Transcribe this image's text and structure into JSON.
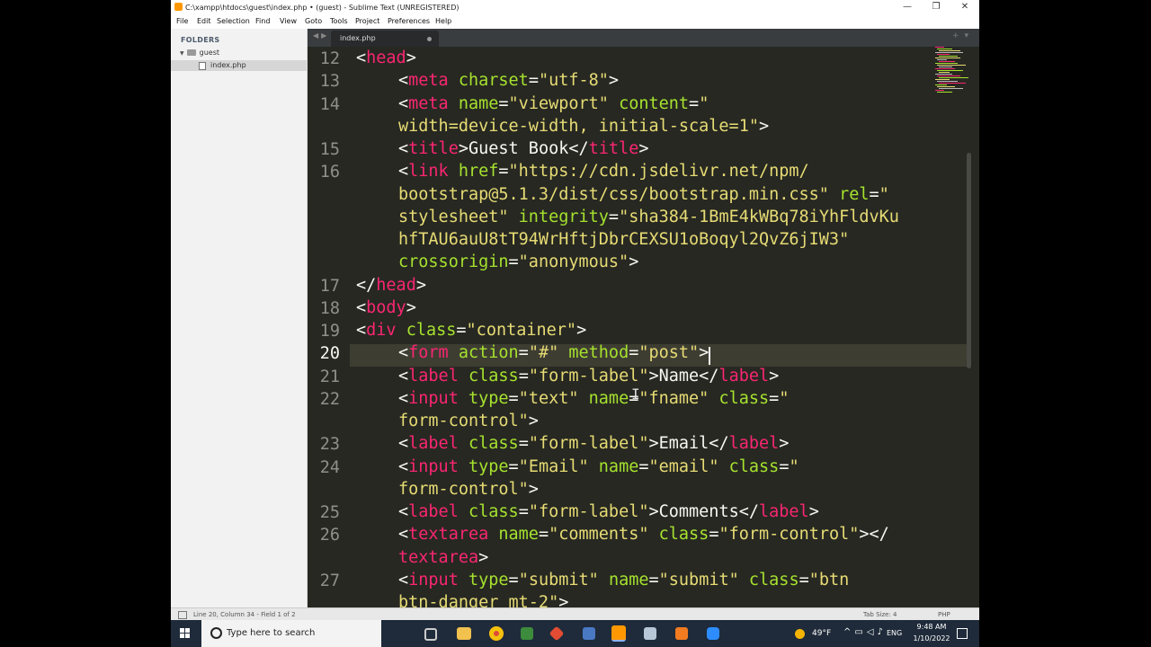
{
  "window": {
    "title": "C:\\xampp\\htdocs\\guest\\index.php • (guest) - Sublime Text (UNREGISTERED)",
    "controls": {
      "minimize": "—",
      "restore": "❐",
      "close": "✕"
    }
  },
  "menu": [
    "File",
    "Edit",
    "Selection",
    "Find",
    "View",
    "Goto",
    "Tools",
    "Project",
    "Preferences",
    "Help"
  ],
  "sidebar": {
    "header": "FOLDERS",
    "folder": "guest",
    "file": "index.php"
  },
  "tabs": [
    {
      "label": "index.php",
      "modified": true
    }
  ],
  "editor": {
    "active_line": "20",
    "gutter": [
      {
        "n": "12"
      },
      {
        "n": "13"
      },
      {
        "n": "14"
      },
      {
        "n": ""
      },
      {
        "n": "15"
      },
      {
        "n": "16"
      },
      {
        "n": ""
      },
      {
        "n": ""
      },
      {
        "n": ""
      },
      {
        "n": ""
      },
      {
        "n": "17"
      },
      {
        "n": "18"
      },
      {
        "n": "19"
      },
      {
        "n": "20"
      },
      {
        "n": "21"
      },
      {
        "n": "22"
      },
      {
        "n": ""
      },
      {
        "n": "23"
      },
      {
        "n": "24"
      },
      {
        "n": ""
      },
      {
        "n": "25"
      },
      {
        "n": "26"
      },
      {
        "n": ""
      },
      {
        "n": "27"
      },
      {
        "n": ""
      }
    ],
    "lines": [
      {
        "tokens": [
          [
            "p",
            "<"
          ],
          [
            "t",
            "head"
          ],
          [
            "p",
            ">"
          ]
        ]
      },
      {
        "in": 1,
        "tokens": [
          [
            "p",
            "<"
          ],
          [
            "t",
            "meta"
          ],
          [
            "p",
            " "
          ],
          [
            "a",
            "charset"
          ],
          [
            "p",
            "="
          ],
          [
            "s",
            "\"utf-8\""
          ],
          [
            "p",
            ">"
          ]
        ]
      },
      {
        "in": 1,
        "tokens": [
          [
            "p",
            "<"
          ],
          [
            "t",
            "meta"
          ],
          [
            "p",
            " "
          ],
          [
            "a",
            "name"
          ],
          [
            "p",
            "="
          ],
          [
            "s",
            "\"viewport\""
          ],
          [
            "p",
            " "
          ],
          [
            "a",
            "content"
          ],
          [
            "p",
            "="
          ],
          [
            "s",
            "\""
          ]
        ]
      },
      {
        "in": 1,
        "tokens": [
          [
            "s",
            "width=device-width, initial-scale=1\""
          ],
          [
            "p",
            ">"
          ]
        ]
      },
      {
        "in": 1,
        "tokens": [
          [
            "p",
            "<"
          ],
          [
            "t",
            "title"
          ],
          [
            "p",
            ">Guest Book</"
          ],
          [
            "t",
            "title"
          ],
          [
            "p",
            ">"
          ]
        ]
      },
      {
        "in": 1,
        "tokens": [
          [
            "p",
            "<"
          ],
          [
            "t",
            "link"
          ],
          [
            "p",
            " "
          ],
          [
            "a",
            "href"
          ],
          [
            "p",
            "="
          ],
          [
            "s",
            "\"https://cdn.jsdelivr.net/npm/"
          ]
        ]
      },
      {
        "in": 1,
        "tokens": [
          [
            "s",
            "bootstrap@5.1.3/dist/css/bootstrap.min.css\""
          ],
          [
            "p",
            " "
          ],
          [
            "a",
            "rel"
          ],
          [
            "p",
            "="
          ],
          [
            "s",
            "\""
          ]
        ]
      },
      {
        "in": 1,
        "tokens": [
          [
            "s",
            "stylesheet\""
          ],
          [
            "p",
            " "
          ],
          [
            "a",
            "integrity"
          ],
          [
            "p",
            "="
          ],
          [
            "s",
            "\"sha384-1BmE4kWBq78iYhFldvKu"
          ]
        ]
      },
      {
        "in": 1,
        "tokens": [
          [
            "s",
            "hfTAU6auU8tT94WrHftjDbrCEXSU1oBoqyl2QvZ6jIW3\""
          ]
        ]
      },
      {
        "in": 1,
        "tokens": [
          [
            "a",
            "crossorigin"
          ],
          [
            "p",
            "="
          ],
          [
            "s",
            "\"anonymous\""
          ],
          [
            "p",
            ">"
          ]
        ]
      },
      {
        "tokens": [
          [
            "p",
            "</"
          ],
          [
            "t",
            "head"
          ],
          [
            "p",
            ">"
          ]
        ]
      },
      {
        "tokens": [
          [
            "p",
            "<"
          ],
          [
            "t",
            "body"
          ],
          [
            "p",
            ">"
          ]
        ]
      },
      {
        "tokens": [
          [
            "p",
            "<"
          ],
          [
            "t",
            "div"
          ],
          [
            "p",
            " "
          ],
          [
            "a",
            "class"
          ],
          [
            "p",
            "="
          ],
          [
            "s",
            "\"container\""
          ],
          [
            "p",
            ">"
          ]
        ]
      },
      {
        "in": 1,
        "tokens": [
          [
            "p",
            "<"
          ],
          [
            "t",
            "form"
          ],
          [
            "p",
            " "
          ],
          [
            "a",
            "action"
          ],
          [
            "p",
            "="
          ],
          [
            "s",
            "\"#\""
          ],
          [
            "p",
            " "
          ],
          [
            "a",
            "method"
          ],
          [
            "p",
            "="
          ],
          [
            "s",
            "\"post\""
          ],
          [
            "p",
            ">"
          ]
        ]
      },
      {
        "in": 1,
        "tokens": [
          [
            "p",
            "<"
          ],
          [
            "t",
            "label"
          ],
          [
            "p",
            " "
          ],
          [
            "a",
            "class"
          ],
          [
            "p",
            "="
          ],
          [
            "s",
            "\"form-label\""
          ],
          [
            "p",
            ">Name</"
          ],
          [
            "t",
            "label"
          ],
          [
            "p",
            ">"
          ]
        ]
      },
      {
        "in": 1,
        "tokens": [
          [
            "p",
            "<"
          ],
          [
            "t",
            "input"
          ],
          [
            "p",
            " "
          ],
          [
            "a",
            "type"
          ],
          [
            "p",
            "="
          ],
          [
            "s",
            "\"text\""
          ],
          [
            "p",
            " "
          ],
          [
            "a",
            "name"
          ],
          [
            "p",
            "="
          ],
          [
            "s",
            "\"fname\""
          ],
          [
            "p",
            " "
          ],
          [
            "a",
            "class"
          ],
          [
            "p",
            "="
          ],
          [
            "s",
            "\""
          ]
        ]
      },
      {
        "in": 1,
        "tokens": [
          [
            "s",
            "form-control\""
          ],
          [
            "p",
            ">"
          ]
        ]
      },
      {
        "in": 1,
        "tokens": [
          [
            "p",
            "<"
          ],
          [
            "t",
            "label"
          ],
          [
            "p",
            " "
          ],
          [
            "a",
            "class"
          ],
          [
            "p",
            "="
          ],
          [
            "s",
            "\"form-label\""
          ],
          [
            "p",
            ">Email</"
          ],
          [
            "t",
            "label"
          ],
          [
            "p",
            ">"
          ]
        ]
      },
      {
        "in": 1,
        "tokens": [
          [
            "p",
            "<"
          ],
          [
            "t",
            "input"
          ],
          [
            "p",
            " "
          ],
          [
            "a",
            "type"
          ],
          [
            "p",
            "="
          ],
          [
            "s",
            "\"Email\""
          ],
          [
            "p",
            " "
          ],
          [
            "a",
            "name"
          ],
          [
            "p",
            "="
          ],
          [
            "s",
            "\"email\""
          ],
          [
            "p",
            " "
          ],
          [
            "a",
            "class"
          ],
          [
            "p",
            "="
          ],
          [
            "s",
            "\""
          ]
        ]
      },
      {
        "in": 1,
        "tokens": [
          [
            "s",
            "form-control\""
          ],
          [
            "p",
            ">"
          ]
        ]
      },
      {
        "in": 1,
        "tokens": [
          [
            "p",
            "<"
          ],
          [
            "t",
            "label"
          ],
          [
            "p",
            " "
          ],
          [
            "a",
            "class"
          ],
          [
            "p",
            "="
          ],
          [
            "s",
            "\"form-label\""
          ],
          [
            "p",
            ">Comments</"
          ],
          [
            "t",
            "label"
          ],
          [
            "p",
            ">"
          ]
        ]
      },
      {
        "in": 1,
        "tokens": [
          [
            "p",
            "<"
          ],
          [
            "t",
            "textarea"
          ],
          [
            "p",
            " "
          ],
          [
            "a",
            "name"
          ],
          [
            "p",
            "="
          ],
          [
            "s",
            "\"comments\""
          ],
          [
            "p",
            " "
          ],
          [
            "a",
            "class"
          ],
          [
            "p",
            "="
          ],
          [
            "s",
            "\"form-control\""
          ],
          [
            "p",
            "></"
          ]
        ]
      },
      {
        "in": 1,
        "tokens": [
          [
            "t",
            "textarea"
          ],
          [
            "p",
            ">"
          ]
        ]
      },
      {
        "in": 1,
        "tokens": [
          [
            "p",
            "<"
          ],
          [
            "t",
            "input"
          ],
          [
            "p",
            " "
          ],
          [
            "a",
            "type"
          ],
          [
            "p",
            "="
          ],
          [
            "s",
            "\"submit\""
          ],
          [
            "p",
            " "
          ],
          [
            "a",
            "name"
          ],
          [
            "p",
            "="
          ],
          [
            "s",
            "\"submit\""
          ],
          [
            "p",
            " "
          ],
          [
            "a",
            "class"
          ],
          [
            "p",
            "="
          ],
          [
            "s",
            "\"btn"
          ]
        ]
      },
      {
        "in": 1,
        "tokens": [
          [
            "s",
            "btn-danger mt-2\""
          ],
          [
            "p",
            ">"
          ]
        ]
      }
    ]
  },
  "status": {
    "position": "Line 20, Column 34 - Field 1 of 2",
    "tab_size": "Tab Size: 4",
    "syntax": "PHP"
  },
  "taskbar": {
    "search_placeholder": "Type here to search",
    "apps": [
      "task-view",
      "file-explorer",
      "chrome",
      "xampp-installer",
      "git",
      "virtualbox",
      "sublime-text",
      "control-panel",
      "xampp",
      "zoom"
    ],
    "temperature": "49°F",
    "language": "ENG",
    "time": "9:48 AM",
    "date": "1/10/2022"
  },
  "colors": {
    "tag": "#f92672",
    "attribute": "#a6e22e",
    "string": "#e6db74",
    "text": "#f8f8f2",
    "background": "#272822"
  }
}
